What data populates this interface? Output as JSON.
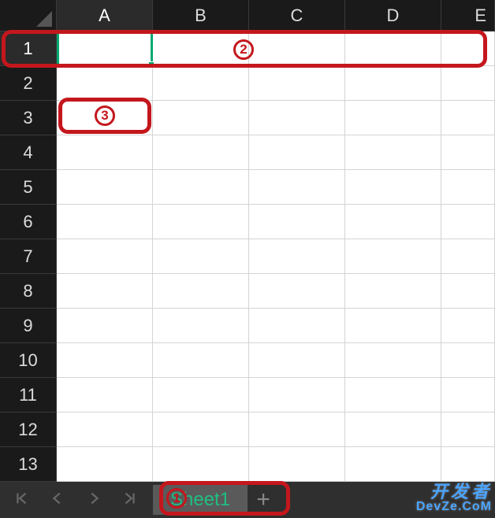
{
  "grid": {
    "columns": [
      "A",
      "B",
      "C",
      "D",
      "E"
    ],
    "rows": [
      "1",
      "2",
      "3",
      "4",
      "5",
      "6",
      "7",
      "8",
      "9",
      "10",
      "11",
      "12",
      "13"
    ],
    "selected_column": "A",
    "selected_row": "1",
    "active_cell": "A1"
  },
  "tabs": {
    "sheet_name": "Sheet1",
    "add_label": "+"
  },
  "annotations": {
    "label1": "1",
    "label2": "2",
    "label3": "3"
  },
  "watermark": {
    "line1": "开发者",
    "line2": "DevZe.CoM"
  }
}
